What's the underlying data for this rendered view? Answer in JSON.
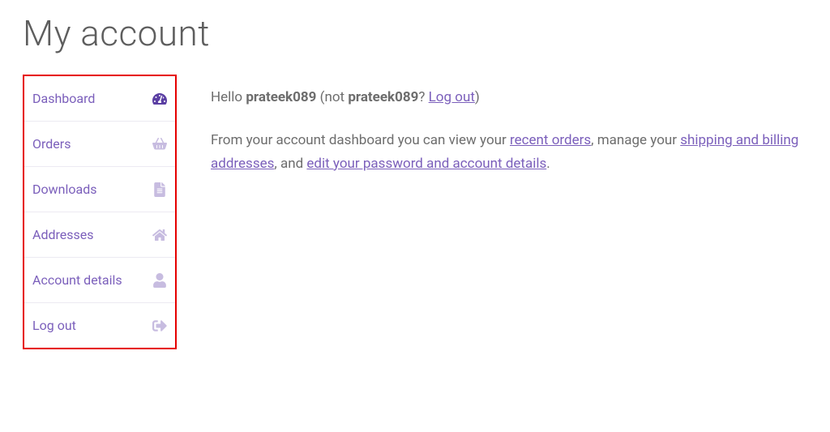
{
  "page_title": "My account",
  "sidebar": {
    "items": [
      {
        "label": "Dashboard",
        "icon": "dashboard-icon",
        "active": true
      },
      {
        "label": "Orders",
        "icon": "basket-icon",
        "active": false
      },
      {
        "label": "Downloads",
        "icon": "file-icon",
        "active": false
      },
      {
        "label": "Addresses",
        "icon": "home-icon",
        "active": false
      },
      {
        "label": "Account details",
        "icon": "user-icon",
        "active": false
      },
      {
        "label": "Log out",
        "icon": "signout-icon",
        "active": false
      }
    ]
  },
  "greeting": {
    "hello": "Hello ",
    "username": "prateek089",
    "not_prefix": " (not ",
    "username_repeat": "prateek089",
    "question": "? ",
    "logout_link": "Log out",
    "close": ")"
  },
  "description": {
    "part1": "From your account dashboard you can view your ",
    "link1": "recent orders",
    "part2": ", manage your ",
    "link2": "shipping and billing addresses",
    "part3": ", and ",
    "link3": "edit your password and account details",
    "part4": "."
  }
}
